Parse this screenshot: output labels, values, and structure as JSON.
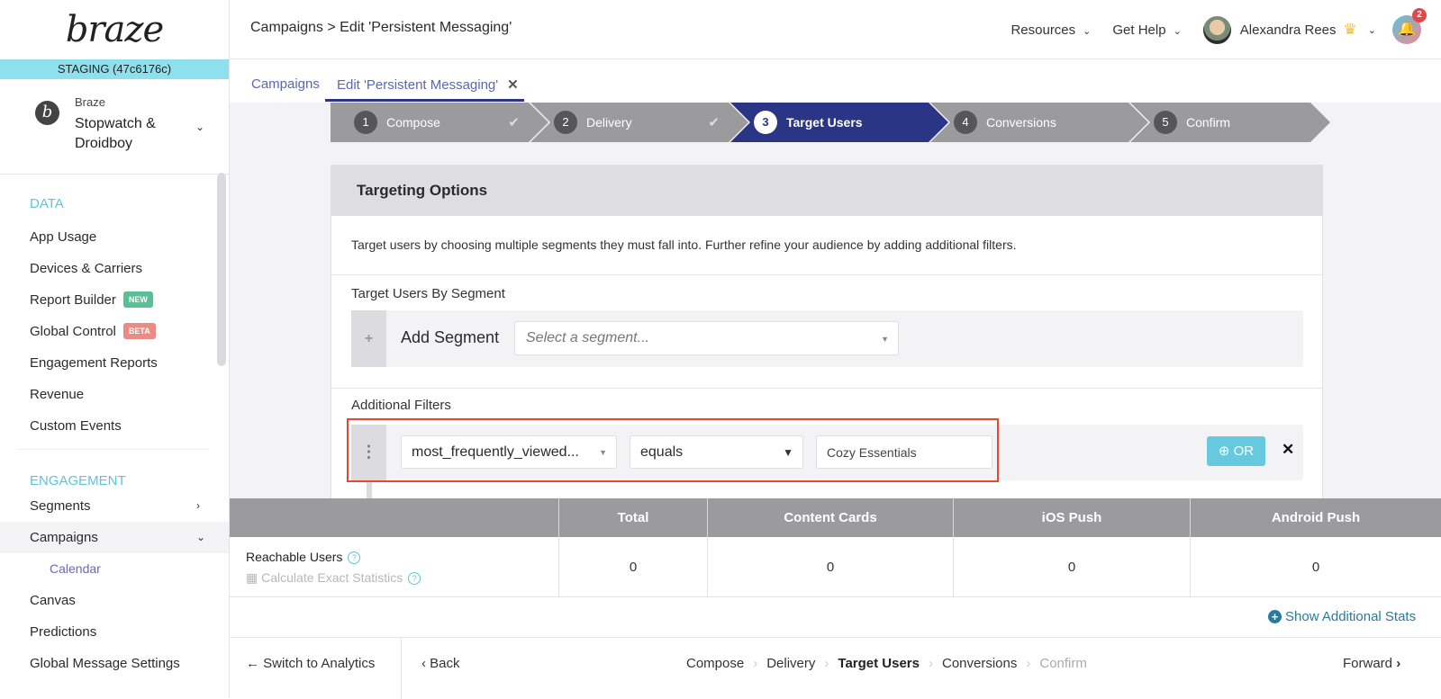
{
  "sidebar": {
    "logo": "braze",
    "environment": "STAGING (47c6176c)",
    "company_brand": "Braze",
    "company_name_line1": "Stopwatch &",
    "company_name_line2": "Droidboy",
    "sections": [
      {
        "title": "DATA",
        "items": [
          {
            "label": "App Usage"
          },
          {
            "label": "Devices & Carriers"
          },
          {
            "label": "Report Builder",
            "badge": "NEW"
          },
          {
            "label": "Global Control",
            "badge": "BETA"
          },
          {
            "label": "Engagement Reports"
          },
          {
            "label": "Revenue"
          },
          {
            "label": "Custom Events"
          }
        ]
      },
      {
        "title": "ENGAGEMENT",
        "items": [
          {
            "label": "Segments"
          },
          {
            "label": "Campaigns",
            "active": true,
            "subitems": [
              {
                "label": "Calendar"
              }
            ]
          },
          {
            "label": "Canvas"
          },
          {
            "label": "Predictions"
          },
          {
            "label": "Global Message Settings"
          }
        ]
      }
    ]
  },
  "header": {
    "breadcrumb": "Campaigns > Edit 'Persistent Messaging'",
    "resources": "Resources",
    "get_help": "Get Help",
    "user_name": "Alexandra Rees",
    "notification_count": "2"
  },
  "tabs": [
    {
      "label": "Campaigns"
    },
    {
      "label": "Edit 'Persistent Messaging'",
      "active": true
    }
  ],
  "steps": [
    {
      "num": "1",
      "label": "Compose",
      "done": true
    },
    {
      "num": "2",
      "label": "Delivery",
      "done": true
    },
    {
      "num": "3",
      "label": "Target Users",
      "current": true
    },
    {
      "num": "4",
      "label": "Conversions"
    },
    {
      "num": "5",
      "label": "Confirm"
    }
  ],
  "targeting": {
    "title": "Targeting Options",
    "description": "Target users by choosing multiple segments they must fall into. Further refine your audience by adding additional filters.",
    "segment_section": "Target Users By Segment",
    "add_segment": "Add Segment",
    "segment_placeholder": "Select a segment...",
    "filters_section": "Additional Filters",
    "filter": {
      "attribute": "most_frequently_viewed...",
      "operator": "equals",
      "value": "Cozy Essentials"
    },
    "or_button": "OR"
  },
  "stats": {
    "columns": [
      "Total",
      "Content Cards",
      "iOS Push",
      "Android Push"
    ],
    "row_label": "Reachable Users",
    "calc_label": "Calculate Exact Statistics",
    "values": [
      "0",
      "0",
      "0",
      "0"
    ],
    "show_additional": "Show Additional Stats"
  },
  "footer": {
    "switch": "Switch to Analytics",
    "back": "Back",
    "crumbs": [
      "Compose",
      "Delivery",
      "Target Users",
      "Conversions",
      "Confirm"
    ],
    "forward": "Forward"
  },
  "colors": {
    "accent": "#2a3585",
    "staging": "#8ee0ec",
    "highlight": "#e8472d",
    "or_button": "#67c9dd"
  }
}
